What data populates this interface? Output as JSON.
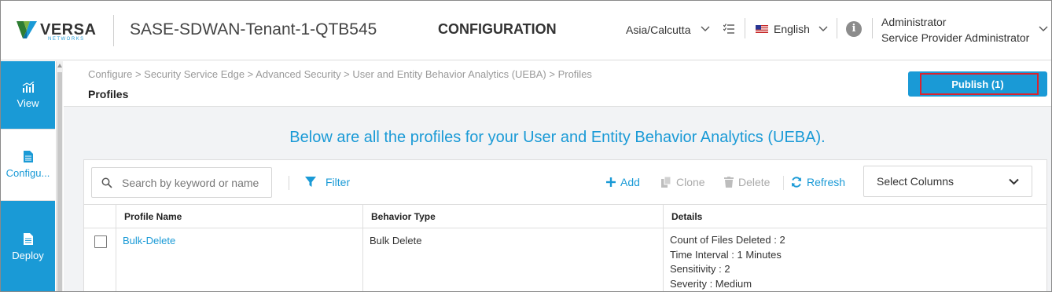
{
  "header": {
    "logo_name": "VERSA",
    "logo_sub": "NETWORKS",
    "tenant": "SASE-SDWAN-Tenant-1-QTB545",
    "section_title": "CONFIGURATION",
    "timezone": "Asia/Calcutta",
    "language": "English",
    "user_role": "Administrator",
    "user_name": "Service Provider Administrator"
  },
  "sidebar": {
    "items": [
      {
        "label": "View",
        "icon": "chart-icon"
      },
      {
        "label": "Configu...",
        "icon": "document-icon"
      },
      {
        "label": "Deploy",
        "icon": "deploy-document-icon"
      }
    ]
  },
  "page": {
    "breadcrumb": "Configure > Security Service Edge > Advanced Security > User and Entity Behavior Analytics (UEBA) > Profiles",
    "title": "Profiles",
    "publish_label": "Publish (1)",
    "banner": "Below are all the profiles for your User and Entity Behavior Analytics (UEBA)."
  },
  "toolbar": {
    "search_placeholder": "Search by keyword or name",
    "filter_label": "Filter",
    "add_label": "Add",
    "clone_label": "Clone",
    "delete_label": "Delete",
    "refresh_label": "Refresh",
    "select_columns": "Select Columns"
  },
  "table": {
    "columns": [
      "Profile Name",
      "Behavior Type",
      "Details"
    ],
    "rows": [
      {
        "name": "Bulk-Delete",
        "behavior": "Bulk Delete",
        "details": [
          "Count of Files Deleted : 2",
          "Time Interval : 1 Minutes",
          "Sensitivity : 2",
          "Severity : Medium"
        ]
      }
    ]
  },
  "colors": {
    "accent": "#1a9ad6",
    "highlight_outline": "#d9232e"
  }
}
